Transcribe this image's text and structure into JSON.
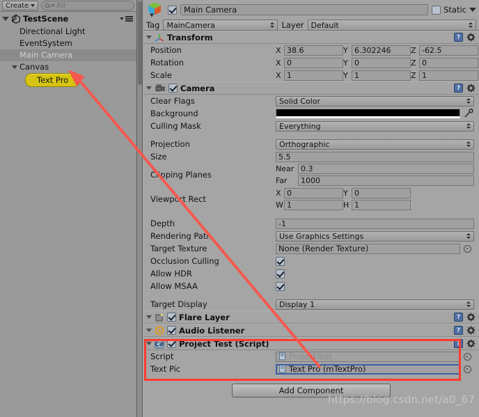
{
  "hierarchy": {
    "create_button": "Create",
    "search_placeholder": "All",
    "scene_name": "TestScene",
    "items": [
      {
        "label": "Directional Light",
        "indent": 1,
        "selected": false,
        "expandable": false
      },
      {
        "label": "EventSystem",
        "indent": 1,
        "selected": false,
        "expandable": false
      },
      {
        "label": "Main Camera",
        "indent": 1,
        "selected": true,
        "expandable": false
      },
      {
        "label": "Canvas",
        "indent": 1,
        "selected": false,
        "expandable": true
      }
    ],
    "highlighted_child": "Text Pro"
  },
  "inspector": {
    "object_name": "Main Camera",
    "object_enabled": true,
    "static_label": "Static",
    "static_checked": false,
    "tag_label": "Tag",
    "tag_value": "MainCamera",
    "layer_label": "Layer",
    "layer_value": "Default",
    "components": [
      {
        "name": "Transform",
        "icon": "transform-icon",
        "has_enable_checkbox": false,
        "rows": [
          {
            "label": "Position",
            "type": "vector3",
            "x": "38.6",
            "y": "6.302246",
            "z": "-62.5"
          },
          {
            "label": "Rotation",
            "type": "vector3",
            "x": "0",
            "y": "0",
            "z": "0"
          },
          {
            "label": "Scale",
            "type": "vector3",
            "x": "1",
            "y": "1",
            "z": "1"
          }
        ]
      },
      {
        "name": "Camera",
        "icon": "camera-icon",
        "has_enable_checkbox": true,
        "enabled": true,
        "rows": [
          {
            "label": "Clear Flags",
            "type": "dropdown",
            "value": "Solid Color"
          },
          {
            "label": "Background",
            "type": "color",
            "value": "#000000"
          },
          {
            "label": "Culling Mask",
            "type": "dropdown",
            "value": "Everything"
          },
          {
            "label": "",
            "type": "spacer"
          },
          {
            "label": "Projection",
            "type": "dropdown",
            "value": "Orthographic"
          },
          {
            "label": "Size",
            "type": "text",
            "value": "5.5"
          },
          {
            "label": "Clipping Planes",
            "type": "clipping",
            "near_label": "Near",
            "near": "0.3",
            "far_label": "Far",
            "far": "1000"
          },
          {
            "label": "Viewport Rect",
            "type": "rect",
            "x_label": "X",
            "x": "0",
            "y_label": "Y",
            "y": "0",
            "w_label": "W",
            "w": "1",
            "h_label": "H",
            "h": "1"
          },
          {
            "label": "",
            "type": "spacer"
          },
          {
            "label": "Depth",
            "type": "text",
            "value": "-1"
          },
          {
            "label": "Rendering Path",
            "type": "dropdown",
            "value": "Use Graphics Settings"
          },
          {
            "label": "Target Texture",
            "type": "object",
            "value": "None (Render Texture)"
          },
          {
            "label": "Occlusion Culling",
            "type": "checkbox",
            "checked": true
          },
          {
            "label": "Allow HDR",
            "type": "checkbox",
            "checked": true
          },
          {
            "label": "Allow MSAA",
            "type": "checkbox",
            "checked": true
          },
          {
            "label": "",
            "type": "spacer"
          },
          {
            "label": "Target Display",
            "type": "dropdown",
            "value": "Display 1"
          }
        ]
      },
      {
        "name": "Flare Layer",
        "icon": "flare-layer-icon",
        "has_enable_checkbox": true,
        "enabled": true,
        "rows": []
      },
      {
        "name": "Audio Listener",
        "icon": "audio-listener-icon",
        "has_enable_checkbox": true,
        "enabled": true,
        "rows": []
      },
      {
        "name": "Project Test (Script)",
        "icon": "csharp-script-icon",
        "has_enable_checkbox": true,
        "enabled": true,
        "rows": [
          {
            "label": "Script",
            "type": "object-disabled",
            "value": "ProjectTest"
          },
          {
            "label": "Text Pic",
            "type": "object-focused",
            "value": "Text Pro (mTextPro)"
          }
        ]
      }
    ],
    "add_component_label": "Add Component"
  },
  "annotations": {
    "highlight_color": "#ff3b30",
    "arrow_color": "#f4594f",
    "watermark": "https://blog.csdn.net/a0_67"
  }
}
